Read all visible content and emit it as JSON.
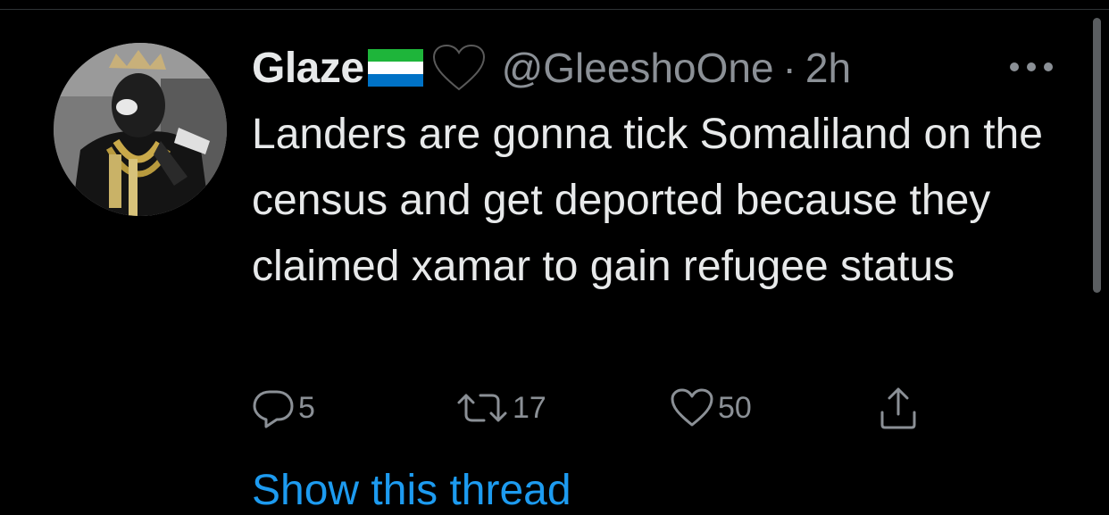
{
  "tweet": {
    "author_name": "Glaze",
    "flag_icon": "sierra-leone-flag-icon",
    "badge_icon": "black-heart-icon",
    "handle": "@GleeshoOne",
    "separator": "·",
    "time": "2h",
    "more_icon": "ellipsis-icon",
    "text": "Landers are gonna tick Somaliland on the census and get deported because they claimed xamar to gain refugee status",
    "actions": {
      "reply": {
        "icon": "reply-icon",
        "count": "5"
      },
      "retweet": {
        "icon": "retweet-icon",
        "count": "17"
      },
      "like": {
        "icon": "heart-icon",
        "count": "50"
      },
      "share": {
        "icon": "share-icon"
      }
    },
    "show_thread_label": "Show this thread"
  },
  "colors": {
    "background": "#000000",
    "text_primary": "#e7e9ea",
    "text_secondary": "#8b9096",
    "link": "#1d9bf0",
    "flag_green": "#1eb53a",
    "flag_white": "#ffffff",
    "flag_blue": "#0072c6"
  }
}
